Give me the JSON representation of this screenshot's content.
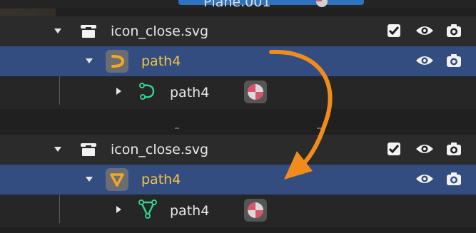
{
  "top_fragment": "Plane.001",
  "group_before": {
    "collection_label": "icon_close.svg",
    "object_label": "path4",
    "curve_data_label": "path4"
  },
  "group_after": {
    "collection_label": "icon_close.svg",
    "object_label": "path4",
    "mesh_data_label": "path4"
  },
  "colors": {
    "selected_row": "#334d80",
    "object_label": "#f5c542",
    "arrow": "#f08c1e",
    "curve_icon": "#2fd38c",
    "mesh_icon": "#2fd38c"
  },
  "icons": {
    "collection": "collection-icon",
    "curve_object": "curve-object-icon",
    "mesh_object": "mesh-object-icon",
    "curve_data": "curve-data-icon",
    "mesh_data": "mesh-data-icon",
    "visibility": "eye-icon",
    "render": "camera-icon",
    "exclude": "checkbox-icon",
    "material": "material-icon",
    "transition": "curved-arrow"
  }
}
